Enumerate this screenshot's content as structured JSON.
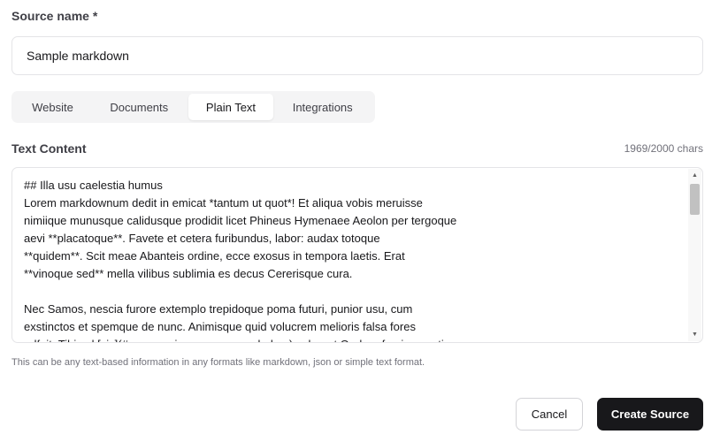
{
  "form": {
    "source_name_label": "Source name *",
    "source_name_value": "Sample markdown",
    "text_content_label": "Text Content",
    "char_count": "1969/2000 chars",
    "helper_text": "This can be any text-based information in any formats like markdown, json or simple text format."
  },
  "tabs": [
    {
      "label": "Website",
      "active": false
    },
    {
      "label": "Documents",
      "active": false
    },
    {
      "label": "Plain Text",
      "active": true
    },
    {
      "label": "Integrations",
      "active": false
    }
  ],
  "textarea": {
    "content": "## Illa usu caelestia humus\nLorem markdownum dedit in emicat *tantum ut quot*! Et aliqua vobis meruisse\nnimiique munusque calidusque prodidit licet Phineus Hymenaee Aeolon per tergoque\naevi **placatoque**. Favete et cetera furibundus, labor: audax totoque\n**quidem**. Scit meae Abanteis ordine, ecce exosus in tempora laetis. Erat\n**vinoque sed** mella vilibus sublimia es decus Cererisque cura.\n\nNec Samos, nescia furore extemplo trepidoque poma futuri, punior usu, cum\nexstinctos et spemque de nunc. Animisque quid volucrem melioris falsa fores\nadfuit. Tibi vel [sic](#a_cacumine_numero_ambobus) vulneret Orphea femina saetis"
  },
  "buttons": {
    "cancel_label": "Cancel",
    "create_label": "Create Source"
  },
  "icons": {
    "scroll_up": "▲",
    "scroll_down": "▼"
  }
}
